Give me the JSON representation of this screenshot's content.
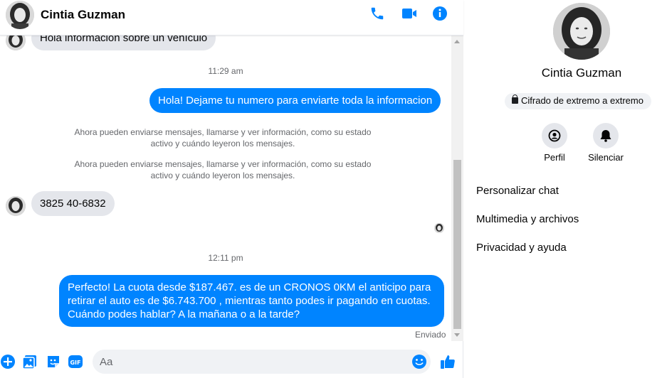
{
  "header": {
    "contact_name": "Cintia Guzman"
  },
  "messages": {
    "incoming_cut": "Hola información sobre un vehículo",
    "time_1": "11:29 am",
    "outgoing_1": "Hola! Dejame tu numero  para enviarte toda la informacion",
    "system_1_line1": "Ahora pueden enviarse mensajes, llamarse y ver información, como su estado",
    "system_1_line2": "activo y cuándo leyeron los mensajes.",
    "system_2_line1": "Ahora pueden enviarse mensajes, llamarse y ver información, como su estado",
    "system_2_line2": "activo y cuándo leyeron los mensajes.",
    "incoming_phone": "3825 40-6832",
    "time_2": "12:11 pm",
    "outgoing_2_line1": "Perfecto! La cuota desde $187.467. es de un CRONOS 0KM el anticipo para",
    "outgoing_2_line2": "retirar el auto es de $6.743.700 , mientras tanto podes ir pagando en cuotas.",
    "outgoing_2_line3": "Cuándo podes hablar? A la mañana o a la tarde?",
    "status": "Enviado"
  },
  "composer": {
    "placeholder": "Aa"
  },
  "panel": {
    "contact_name": "Cintia Guzman",
    "encryption_label": "Cifrado de extremo a extremo",
    "profile_label": "Perfil",
    "mute_label": "Silenciar",
    "menu": [
      "Personalizar chat",
      "Multimedia y archivos",
      "Privacidad y ayuda"
    ]
  },
  "colors": {
    "accent": "#0084ff",
    "bubble_in": "#e4e6eb",
    "secondary_text": "#65676b"
  }
}
